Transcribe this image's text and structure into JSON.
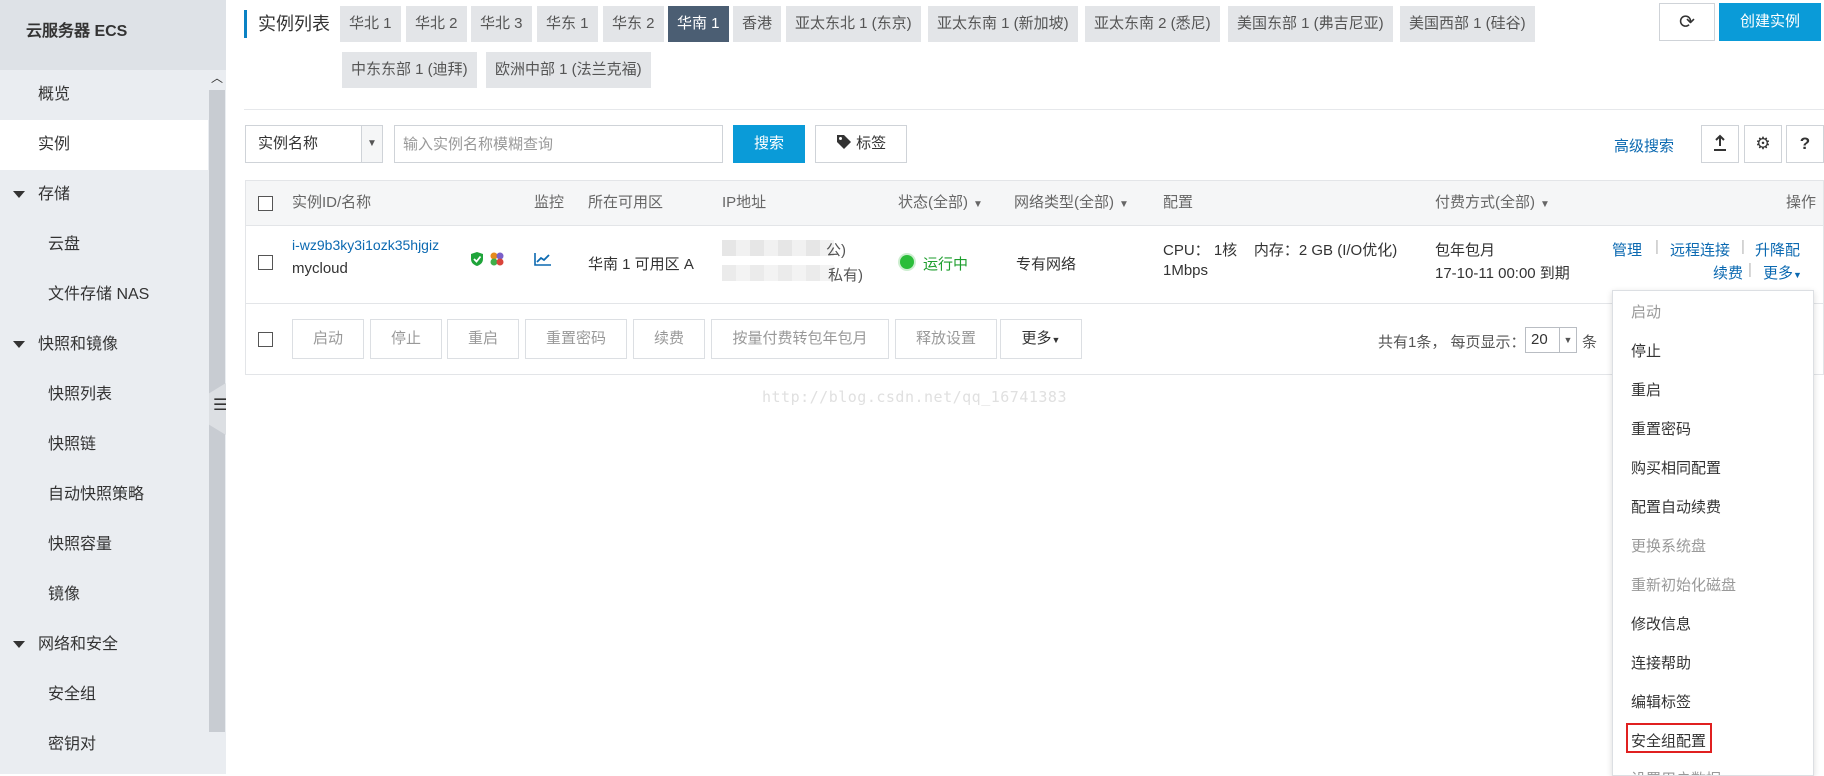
{
  "sidebar": {
    "title": "云服务器 ECS",
    "items": [
      {
        "label": "概览"
      },
      {
        "label": "实例"
      },
      {
        "label": "存储"
      },
      {
        "label": "云盘"
      },
      {
        "label": "文件存储 NAS"
      },
      {
        "label": "快照和镜像"
      },
      {
        "label": "快照列表"
      },
      {
        "label": "快照链"
      },
      {
        "label": "自动快照策略"
      },
      {
        "label": "快照容量"
      },
      {
        "label": "镜像"
      },
      {
        "label": "网络和安全"
      },
      {
        "label": "安全组"
      },
      {
        "label": "密钥对"
      }
    ]
  },
  "header": {
    "title": "实例列表",
    "regions": [
      "华北 1",
      "华北 2",
      "华北 3",
      "华东 1",
      "华东 2",
      "华南 1",
      "香港",
      "亚太东北 1 (东京)",
      "亚太东南 1 (新加坡)",
      "亚太东南 2 (悉尼)",
      "美国东部 1 (弗吉尼亚)",
      "美国西部 1 (硅谷)",
      "中东东部 1 (迪拜)",
      "欧洲中部 1 (法兰克福)"
    ],
    "active_region": "华南 1",
    "refresh_icon": "⟳",
    "create_label": "创建实例"
  },
  "search": {
    "select_value": "实例名称",
    "placeholder": "输入实例名称模糊查询",
    "search_label": "搜索",
    "tag_label": "标签",
    "advanced_label": "高级搜索"
  },
  "table": {
    "headers": {
      "id_name": "实例ID/名称",
      "monitor": "监控",
      "zone": "所在可用区",
      "ip": "IP地址",
      "status": "状态(全部)",
      "network": "网络类型(全部)",
      "config": "配置",
      "billing": "付费方式(全部)",
      "ops": "操作"
    },
    "rows": [
      {
        "id": "i-wz9b3ky3i1ozk35hjgiz",
        "name": "mycloud",
        "zone": "华南 1 可用区 A",
        "ip_public_suffix": "公)",
        "ip_private_suffix": "私有)",
        "status": "运行中",
        "network": "专有网络",
        "config_line1": "CPU： 1核    内存：2 GB (I/O优化)",
        "config_line2": "1Mbps",
        "billing_line1": "包年包月",
        "billing_line2": "17-10-11 00:00 到期",
        "op_manage": "管理",
        "op_remote": "远程连接",
        "op_upgrade": "升降配",
        "op_renew": "续费",
        "op_more": "更多"
      }
    ],
    "footer_buttons": [
      "启动",
      "停止",
      "重启",
      "重置密码",
      "续费",
      "按量付费转包年包月",
      "释放设置",
      "更多"
    ],
    "pager_prefix": "共有1条， 每页显示：",
    "page_size": "20",
    "pager_suffix": "条"
  },
  "watermark": "http://blog.csdn.net/qq_16741383",
  "more_menu": {
    "items": [
      "启动",
      "停止",
      "重启",
      "重置密码",
      "购买相同配置",
      "配置自动续费",
      "更换系统盘",
      "重新初始化磁盘",
      "修改信息",
      "连接帮助",
      "编辑标签",
      "安全组配置",
      "设置用户数据"
    ],
    "highlighted": "安全组配置"
  },
  "colors": {
    "accent": "#0a9bd8",
    "link": "#0b69b1",
    "active_region": "#4b5e73",
    "running": "#1e9e2e",
    "highlight_box": "#e02020"
  }
}
